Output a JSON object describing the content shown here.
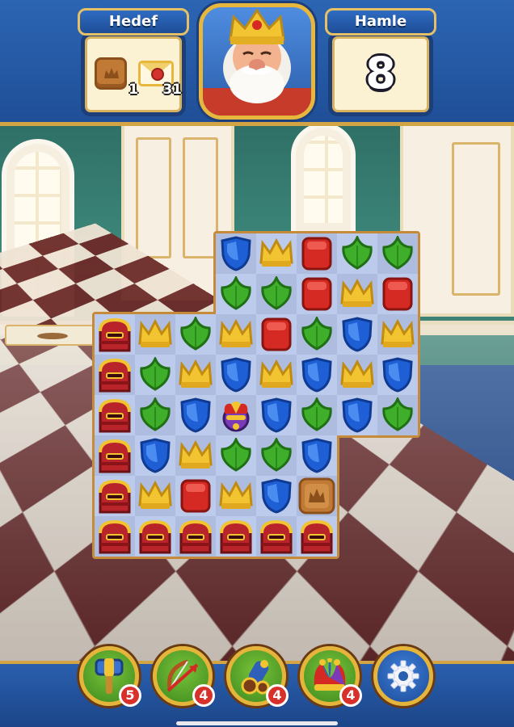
{
  "hud": {
    "goal_label": "Hedef",
    "moves_label": "Hamle",
    "moves_value": "8",
    "goals": [
      {
        "icon": "crate-icon",
        "count": "1"
      },
      {
        "icon": "envelope-icon",
        "count": "31"
      }
    ]
  },
  "board": {
    "rows": [
      [
        "empty",
        "empty",
        "empty",
        "shield",
        "crown",
        "box",
        "leaf",
        "leaf"
      ],
      [
        "empty",
        "empty",
        "empty",
        "leaf",
        "leaf",
        "box",
        "crown",
        "box"
      ],
      [
        "mailbox",
        "crown",
        "leaf",
        "crown",
        "box",
        "leaf",
        "shield",
        "crown"
      ],
      [
        "mailbox",
        "leaf",
        "crown",
        "shield",
        "crown",
        "shield",
        "crown",
        "shield"
      ],
      [
        "mailbox",
        "leaf",
        "shield",
        "jester-bomb",
        "shield",
        "leaf",
        "shield",
        "leaf"
      ],
      [
        "mailbox",
        "shield",
        "crown",
        "leaf",
        "leaf",
        "shield",
        "empty",
        "empty"
      ],
      [
        "mailbox",
        "crown",
        "box",
        "crown",
        "shield",
        "crate",
        "empty",
        "empty"
      ],
      [
        "mailbox",
        "mailbox",
        "mailbox",
        "mailbox",
        "mailbox",
        "mailbox",
        "empty",
        "empty"
      ]
    ]
  },
  "boosters": [
    {
      "name": "hammer",
      "count": "5"
    },
    {
      "name": "arrow",
      "count": "4"
    },
    {
      "name": "cannon",
      "count": "4"
    },
    {
      "name": "jester-hat",
      "count": "4"
    }
  ],
  "colors": {
    "shield": "#1f5fd6",
    "crown": "#f2c431",
    "box": "#d42a23",
    "leaf": "#3fae2a",
    "mailbox": "#b8242a",
    "crate": "#c07a35"
  }
}
